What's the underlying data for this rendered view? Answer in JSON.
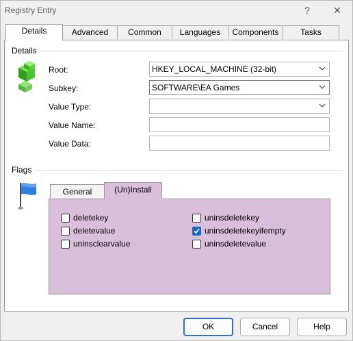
{
  "window": {
    "title": "Registry Entry",
    "help_glyph": "?",
    "close_glyph": "✕"
  },
  "tabs": [
    "Details",
    "Advanced",
    "Common",
    "Languages",
    "Components",
    "Tasks"
  ],
  "details": {
    "section_label": "Details",
    "root": {
      "label": "Root:",
      "value": "HKEY_LOCAL_MACHINE (32-bit)"
    },
    "subkey": {
      "label": "Subkey:",
      "value": "SOFTWARE\\EA Games"
    },
    "value_type": {
      "label": "Value Type:",
      "value": ""
    },
    "value_name": {
      "label": "Value Name:",
      "value": ""
    },
    "value_data": {
      "label": "Value Data:",
      "value": ""
    }
  },
  "flags": {
    "section_label": "Flags",
    "tabs": [
      "General",
      "(Un)Install"
    ],
    "active_tab": "(Un)Install",
    "checkboxes": [
      {
        "label": "deletekey",
        "checked": false
      },
      {
        "label": "deletevalue",
        "checked": false
      },
      {
        "label": "uninsclearvalue",
        "checked": false
      },
      {
        "label": "uninsdeletekey",
        "checked": false
      },
      {
        "label": "uninsdeletekeyifempty",
        "checked": true
      },
      {
        "label": "uninsdeletevalue",
        "checked": false
      }
    ],
    "panel_color": "#d9bfd9"
  },
  "buttons": {
    "ok": "OK",
    "cancel": "Cancel",
    "help": "Help"
  },
  "icons": {
    "root_icon": "registry-cubes-icon",
    "flags_icon": "blue-flag-icon",
    "accent": "#1a66c4"
  }
}
